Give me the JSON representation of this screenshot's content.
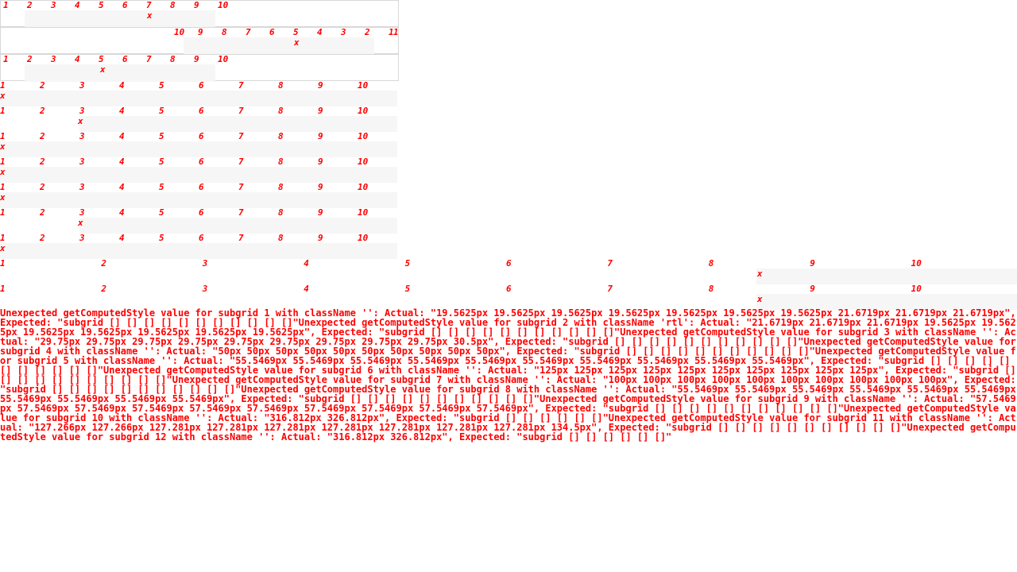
{
  "grid_numbers": [
    "1",
    "2",
    "3",
    "4",
    "5",
    "6",
    "7",
    "8",
    "9",
    "10"
  ],
  "grid_numbers_reversed": [
    "10",
    "9",
    "8",
    "7",
    "6",
    "5",
    "4",
    "3",
    "2",
    "1"
  ],
  "marker": "x",
  "error_log": "Unexpected getComputedStyle value for subgrid 1 with className '': Actual: \"19.5625px 19.5625px 19.5625px 19.5625px 19.5625px 19.5625px 19.5625px 21.6719px 21.6719px 21.6719px\", Expected: \"subgrid [] [] [] [] [] [] [] [] [] [] []\"Unexpected getComputedStyle value for subgrid 2 with className 'rtl': Actual: \"21.6719px 21.6719px 21.6719px 19.5625px 19.5625px 19.5625px 19.5625px 19.5625px 19.5625px 19.5625px\", Expected: \"subgrid [] [] [] [] [] [] [] [] [] [] []\"Unexpected getComputedStyle value for subgrid 3 with className '': Actual: \"29.75px 29.75px 29.75px 29.75px 29.75px 29.75px 29.75px 29.75px 29.75px 30.5px\", Expected: \"subgrid [] [] [] [] [] [] [] [] [] [] []\"Unexpected getComputedStyle value for subgrid 4 with className '': Actual: \"50px 50px 50px 50px 50px 50px 50px 50px 50px 50px\", Expected: \"subgrid [] [] [] [] [] [] [] [] [] [] []\"Unexpected getComputedStyle value for subgrid 5 with className '': Actual: \"55.5469px 55.5469px 55.5469px 55.5469px 55.5469px 55.5469px 55.5469px 55.5469px 55.5469px 55.5469px\", Expected: \"subgrid [] [] [] [] [] [] [] [] [] [] []\"Unexpected getComputedStyle value for subgrid 6 with className '': Actual: \"125px 125px 125px 125px 125px 125px 125px 125px 125px 125px\", Expected: \"subgrid [] [] [] [] [] [] [] [] [] [] []\"Unexpected getComputedStyle value for subgrid 7 with className '': Actual: \"100px 100px 100px 100px 100px 100px 100px 100px 100px 100px\", Expected: \"subgrid [] [] [] [] [] [] [] [] [] [] []\"Unexpected getComputedStyle value for subgrid 8 with className '': Actual: \"55.5469px 55.5469px 55.5469px 55.5469px 55.5469px 55.5469px 55.5469px 55.5469px 55.5469px 55.5469px\", Expected: \"subgrid [] [] [] [] [] [] [] [] [] [] []\"Unexpected getComputedStyle value for subgrid 9 with className '': Actual: \"57.5469px 57.5469px 57.5469px 57.5469px 57.5469px 57.5469px 57.5469px 57.5469px 57.5469px 57.5469px\", Expected: \"subgrid [] [] [] [] [] [] [] [] [] [] []\"Unexpected getComputedStyle value for subgrid 10 with className '': Actual: \"316.812px 326.812px\", Expected: \"subgrid [] [] [] [] [] []\"Unexpected getComputedStyle value for subgrid 11 with className '': Actual: \"127.266px 127.266px 127.281px 127.281px 127.281px 127.281px 127.281px 127.281px 127.281px 134.5px\", Expected: \"subgrid [] [] [] [] [] [] [] [] [] [] []\"Unexpected getComputedStyle value for subgrid 12 with className '': Actual: \"316.812px 326.812px\", Expected: \"subgrid [] [] [] [] [] []\""
}
